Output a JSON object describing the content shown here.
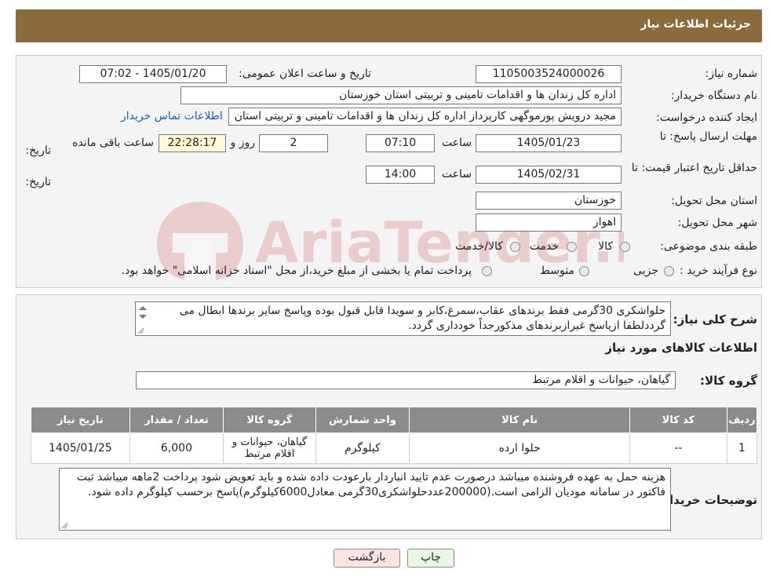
{
  "page": {
    "title": "جزئیات اطلاعات نیاز"
  },
  "watermark": {
    "text": "AriaTender.neT",
    "color": "#c21f1f"
  },
  "info": {
    "need_number_label": "شماره نیاز:",
    "need_number": "1105003524000026",
    "announce_label": "تاریخ و ساعت اعلان عمومی:",
    "announce_value": "1405/01/20 - 07:02",
    "buyer_org_label": "نام دستگاه خریدار:",
    "buyer_org": "اداره کل زندان ها و اقدامات تامینی و تربیتی استان خوزستان",
    "creator_label": "ایجاد کننده درخواست:",
    "creator": "مجید درویش پورموگهی کارپرداز اداره کل زندان ها و اقدامات تامینی و تربیتی استان",
    "contact_link": "اطلاعات تماس خریدار",
    "deadline_label_1": "مهلت ارسال پاسخ: تا",
    "deadline_label_2": "تاریخ:",
    "deadline_date": "1405/01/23",
    "time_label": "ساعت",
    "deadline_time": "07:10",
    "days_value": "2",
    "days_label": "روز و",
    "remaining_time": "22:28:17",
    "remaining_label": "ساعت باقی مانده",
    "validity_label_1": "حداقل تاریخ اعتبار قیمت: تا",
    "validity_label_2": "تاریخ:",
    "validity_date": "1405/02/31",
    "validity_time_label": "ساعت",
    "validity_time": "14:00",
    "province_label": "استان محل تحویل:",
    "province": "خوزستان",
    "city_label": "شهر محل تحویل:",
    "city": "اهواز",
    "category_label": "طبقه بندی موضوعی:",
    "category_options": [
      "کالا",
      "خدمت",
      "کالا/خدمت"
    ],
    "process_label": "نوع فرآیند خرید :",
    "process_options": [
      "جزیی",
      "متوسط"
    ],
    "process_note": "پرداخت تمام یا بخشی از مبلغ خرید،از محل \"اسناد خزانه اسلامی\" خواهد بود."
  },
  "summary": {
    "label": "شرح کلی نیاز:",
    "text": "حلواشکری 30گرمی فقط برندهای عقاب،سمرغ،کابر و سویدا قابل قبول بوده وپاسخ سایر برندها ابطال می گرددلطفا ازپاسخ غیرازبرندهای مذکورجداً خودداری گردد."
  },
  "goods": {
    "section_title": "اطلاعات کالاهای مورد نیاز",
    "group_label": "گروه کالا:",
    "group_value": "گیاهان، حیوانات و اقلام مرتبط",
    "columns": [
      "ردیف",
      "کد کالا",
      "نام کالا",
      "واحد شمارش",
      "گروه کالا",
      "تعداد / مقدار",
      "تاریخ نیاز"
    ],
    "rows": [
      [
        "1",
        "--",
        "حلوا ارده",
        "کیلوگرم",
        "گیاهان، حیوانات و اقلام مرتبط",
        "6,000",
        "1405/01/25"
      ]
    ]
  },
  "buyer_notes": {
    "label": "توضیحات خریدار:",
    "text": "هزینه حمل به عهده فروشنده میباشد درصورت عدم تایید انباردار بارعودت داده شده و باید تعویض شود پرداخت 2ماهه میباشد ثبت فاکتور در سامانه مودیان الزامی است.(200000عددحلواشکری30گرمی معادل6000کیلوگرم)پاسخ برحسب کیلوگرم داده شود."
  },
  "buttons": {
    "print": "چاپ",
    "back": "بازگشت"
  }
}
